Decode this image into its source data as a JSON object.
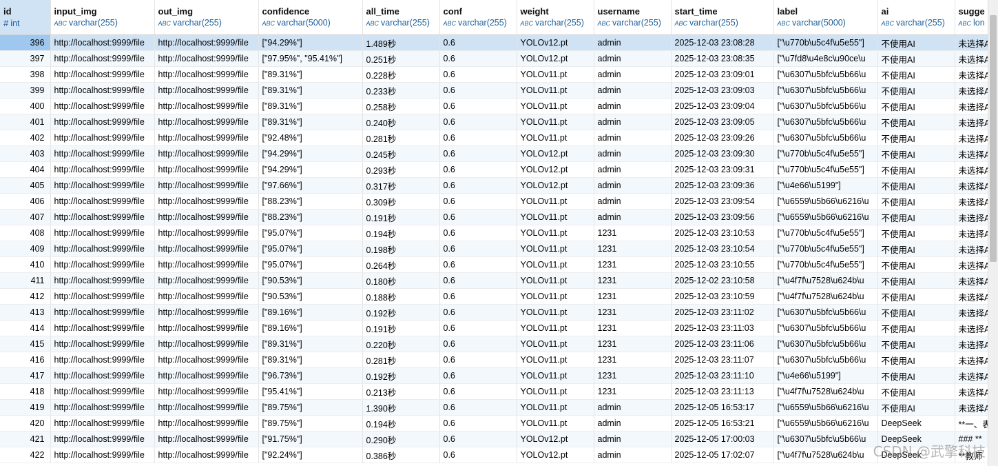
{
  "columns": [
    {
      "name": "id",
      "type": "int",
      "icon": "hash-icon"
    },
    {
      "name": "input_img",
      "type": "varchar(255)",
      "icon": "abc-icon"
    },
    {
      "name": "out_img",
      "type": "varchar(255)",
      "icon": "abc-icon"
    },
    {
      "name": "confidence",
      "type": "varchar(5000)",
      "icon": "abc-icon"
    },
    {
      "name": "all_time",
      "type": "varchar(255)",
      "icon": "abc-icon"
    },
    {
      "name": "conf",
      "type": "varchar(255)",
      "icon": "abc-icon"
    },
    {
      "name": "weight",
      "type": "varchar(255)",
      "icon": "abc-icon"
    },
    {
      "name": "username",
      "type": "varchar(255)",
      "icon": "abc-icon"
    },
    {
      "name": "start_time",
      "type": "varchar(255)",
      "icon": "abc-icon"
    },
    {
      "name": "label",
      "type": "varchar(5000)",
      "icon": "abc-icon"
    },
    {
      "name": "ai",
      "type": "varchar(255)",
      "icon": "abc-icon"
    },
    {
      "name": "sugge",
      "type": "lon",
      "icon": "abc-icon"
    }
  ],
  "rows": [
    [
      "396",
      "http://localhost:9999/file",
      "http://localhost:9999/file",
      "[\"94.29%\"]",
      "1.489秒",
      "0.6",
      "YOLOv12.pt",
      "admin",
      "2025-12-03 23:08:28",
      "[\"\\u770b\\u5c4f\\u5e55\"]",
      "不使用AI",
      "未选择A"
    ],
    [
      "397",
      "http://localhost:9999/file",
      "http://localhost:9999/file",
      "[\"97.95%\", \"95.41%\"]",
      "0.251秒",
      "0.6",
      "YOLOv12.pt",
      "admin",
      "2025-12-03 23:08:35",
      "[\"\\u7fd8\\u4e8c\\u90ce\\u",
      "不使用AI",
      "未选择A"
    ],
    [
      "398",
      "http://localhost:9999/file",
      "http://localhost:9999/file",
      "[\"89.31%\"]",
      "0.228秒",
      "0.6",
      "YOLOv11.pt",
      "admin",
      "2025-12-03 23:09:01",
      "[\"\\u6307\\u5bfc\\u5b66\\u",
      "不使用AI",
      "未选择A"
    ],
    [
      "399",
      "http://localhost:9999/file",
      "http://localhost:9999/file",
      "[\"89.31%\"]",
      "0.233秒",
      "0.6",
      "YOLOv11.pt",
      "admin",
      "2025-12-03 23:09:03",
      "[\"\\u6307\\u5bfc\\u5b66\\u",
      "不使用AI",
      "未选择A"
    ],
    [
      "400",
      "http://localhost:9999/file",
      "http://localhost:9999/file",
      "[\"89.31%\"]",
      "0.258秒",
      "0.6",
      "YOLOv11.pt",
      "admin",
      "2025-12-03 23:09:04",
      "[\"\\u6307\\u5bfc\\u5b66\\u",
      "不使用AI",
      "未选择A"
    ],
    [
      "401",
      "http://localhost:9999/file",
      "http://localhost:9999/file",
      "[\"89.31%\"]",
      "0.240秒",
      "0.6",
      "YOLOv11.pt",
      "admin",
      "2025-12-03 23:09:05",
      "[\"\\u6307\\u5bfc\\u5b66\\u",
      "不使用AI",
      "未选择A"
    ],
    [
      "402",
      "http://localhost:9999/file",
      "http://localhost:9999/file",
      "[\"92.48%\"]",
      "0.281秒",
      "0.6",
      "YOLOv11.pt",
      "admin",
      "2025-12-03 23:09:26",
      "[\"\\u6307\\u5bfc\\u5b66\\u",
      "不使用AI",
      "未选择A"
    ],
    [
      "403",
      "http://localhost:9999/file",
      "http://localhost:9999/file",
      "[\"94.29%\"]",
      "0.245秒",
      "0.6",
      "YOLOv12.pt",
      "admin",
      "2025-12-03 23:09:30",
      "[\"\\u770b\\u5c4f\\u5e55\"]",
      "不使用AI",
      "未选择A"
    ],
    [
      "404",
      "http://localhost:9999/file",
      "http://localhost:9999/file",
      "[\"94.29%\"]",
      "0.293秒",
      "0.6",
      "YOLOv12.pt",
      "admin",
      "2025-12-03 23:09:31",
      "[\"\\u770b\\u5c4f\\u5e55\"]",
      "不使用AI",
      "未选择A"
    ],
    [
      "405",
      "http://localhost:9999/file",
      "http://localhost:9999/file",
      "[\"97.66%\"]",
      "0.317秒",
      "0.6",
      "YOLOv12.pt",
      "admin",
      "2025-12-03 23:09:36",
      "[\"\\u4e66\\u5199\"]",
      "不使用AI",
      "未选择A"
    ],
    [
      "406",
      "http://localhost:9999/file",
      "http://localhost:9999/file",
      "[\"88.23%\"]",
      "0.309秒",
      "0.6",
      "YOLOv11.pt",
      "admin",
      "2025-12-03 23:09:54",
      "[\"\\u6559\\u5b66\\u6216\\u",
      "不使用AI",
      "未选择A"
    ],
    [
      "407",
      "http://localhost:9999/file",
      "http://localhost:9999/file",
      "[\"88.23%\"]",
      "0.191秒",
      "0.6",
      "YOLOv11.pt",
      "admin",
      "2025-12-03 23:09:56",
      "[\"\\u6559\\u5b66\\u6216\\u",
      "不使用AI",
      "未选择A"
    ],
    [
      "408",
      "http://localhost:9999/file",
      "http://localhost:9999/file",
      "[\"95.07%\"]",
      "0.194秒",
      "0.6",
      "YOLOv11.pt",
      "1231",
      "2025-12-03 23:10:53",
      "[\"\\u770b\\u5c4f\\u5e55\"]",
      "不使用AI",
      "未选择A"
    ],
    [
      "409",
      "http://localhost:9999/file",
      "http://localhost:9999/file",
      "[\"95.07%\"]",
      "0.198秒",
      "0.6",
      "YOLOv11.pt",
      "1231",
      "2025-12-03 23:10:54",
      "[\"\\u770b\\u5c4f\\u5e55\"]",
      "不使用AI",
      "未选择A"
    ],
    [
      "410",
      "http://localhost:9999/file",
      "http://localhost:9999/file",
      "[\"95.07%\"]",
      "0.264秒",
      "0.6",
      "YOLOv11.pt",
      "1231",
      "2025-12-03 23:10:55",
      "[\"\\u770b\\u5c4f\\u5e55\"]",
      "不使用AI",
      "未选择A"
    ],
    [
      "411",
      "http://localhost:9999/file",
      "http://localhost:9999/file",
      "[\"90.53%\"]",
      "0.180秒",
      "0.6",
      "YOLOv11.pt",
      "1231",
      "2025-12-02 23:10:58",
      "[\"\\u4f7f\\u7528\\u624b\\u",
      "不使用AI",
      "未选择A"
    ],
    [
      "412",
      "http://localhost:9999/file",
      "http://localhost:9999/file",
      "[\"90.53%\"]",
      "0.188秒",
      "0.6",
      "YOLOv11.pt",
      "1231",
      "2025-12-03 23:10:59",
      "[\"\\u4f7f\\u7528\\u624b\\u",
      "不使用AI",
      "未选择A"
    ],
    [
      "413",
      "http://localhost:9999/file",
      "http://localhost:9999/file",
      "[\"89.16%\"]",
      "0.192秒",
      "0.6",
      "YOLOv11.pt",
      "1231",
      "2025-12-03 23:11:02",
      "[\"\\u6307\\u5bfc\\u5b66\\u",
      "不使用AI",
      "未选择A"
    ],
    [
      "414",
      "http://localhost:9999/file",
      "http://localhost:9999/file",
      "[\"89.16%\"]",
      "0.191秒",
      "0.6",
      "YOLOv11.pt",
      "1231",
      "2025-12-03 23:11:03",
      "[\"\\u6307\\u5bfc\\u5b66\\u",
      "不使用AI",
      "未选择A"
    ],
    [
      "415",
      "http://localhost:9999/file",
      "http://localhost:9999/file",
      "[\"89.31%\"]",
      "0.220秒",
      "0.6",
      "YOLOv11.pt",
      "1231",
      "2025-12-03 23:11:06",
      "[\"\\u6307\\u5bfc\\u5b66\\u",
      "不使用AI",
      "未选择A"
    ],
    [
      "416",
      "http://localhost:9999/file",
      "http://localhost:9999/file",
      "[\"89.31%\"]",
      "0.281秒",
      "0.6",
      "YOLOv11.pt",
      "1231",
      "2025-12-03 23:11:07",
      "[\"\\u6307\\u5bfc\\u5b66\\u",
      "不使用AI",
      "未选择A"
    ],
    [
      "417",
      "http://localhost:9999/file",
      "http://localhost:9999/file",
      "[\"96.73%\"]",
      "0.192秒",
      "0.6",
      "YOLOv11.pt",
      "1231",
      "2025-12-03 23:11:10",
      "[\"\\u4e66\\u5199\"]",
      "不使用AI",
      "未选择A"
    ],
    [
      "418",
      "http://localhost:9999/file",
      "http://localhost:9999/file",
      "[\"95.41%\"]",
      "0.213秒",
      "0.6",
      "YOLOv11.pt",
      "1231",
      "2025-12-03 23:11:13",
      "[\"\\u4f7f\\u7528\\u624b\\u",
      "不使用AI",
      "未选择A"
    ],
    [
      "419",
      "http://localhost:9999/file",
      "http://localhost:9999/file",
      "[\"89.75%\"]",
      "1.390秒",
      "0.6",
      "YOLOv11.pt",
      "admin",
      "2025-12-05 16:53:17",
      "[\"\\u6559\\u5b66\\u6216\\u",
      "不使用AI",
      "未选择A"
    ],
    [
      "420",
      "http://localhost:9999/file",
      "http://localhost:9999/file",
      "[\"89.75%\"]",
      "0.194秒",
      "0.6",
      "YOLOv11.pt",
      "admin",
      "2025-12-05 16:53:21",
      "[\"\\u6559\\u5b66\\u6216\\u",
      "DeepSeek",
      "**一、表"
    ],
    [
      "421",
      "http://localhost:9999/file",
      "http://localhost:9999/file",
      "[\"91.75%\"]",
      "0.290秒",
      "0.6",
      "YOLOv12.pt",
      "admin",
      "2025-12-05 17:00:03",
      "[\"\\u6307\\u5bfc\\u5b66\\u",
      "DeepSeek",
      "### **"
    ],
    [
      "422",
      "http://localhost:9999/file",
      "http://localhost:9999/file",
      "[\"92.24%\"]",
      "0.386秒",
      "0.6",
      "YOLOv12.pt",
      "admin",
      "2025-12-05 17:02:07",
      "[\"\\u4f7f\\u7528\\u624b\\u",
      "DeepSeek",
      "**教师"
    ]
  ],
  "selected_row": 0,
  "watermark": "CSDN @武擎科技"
}
